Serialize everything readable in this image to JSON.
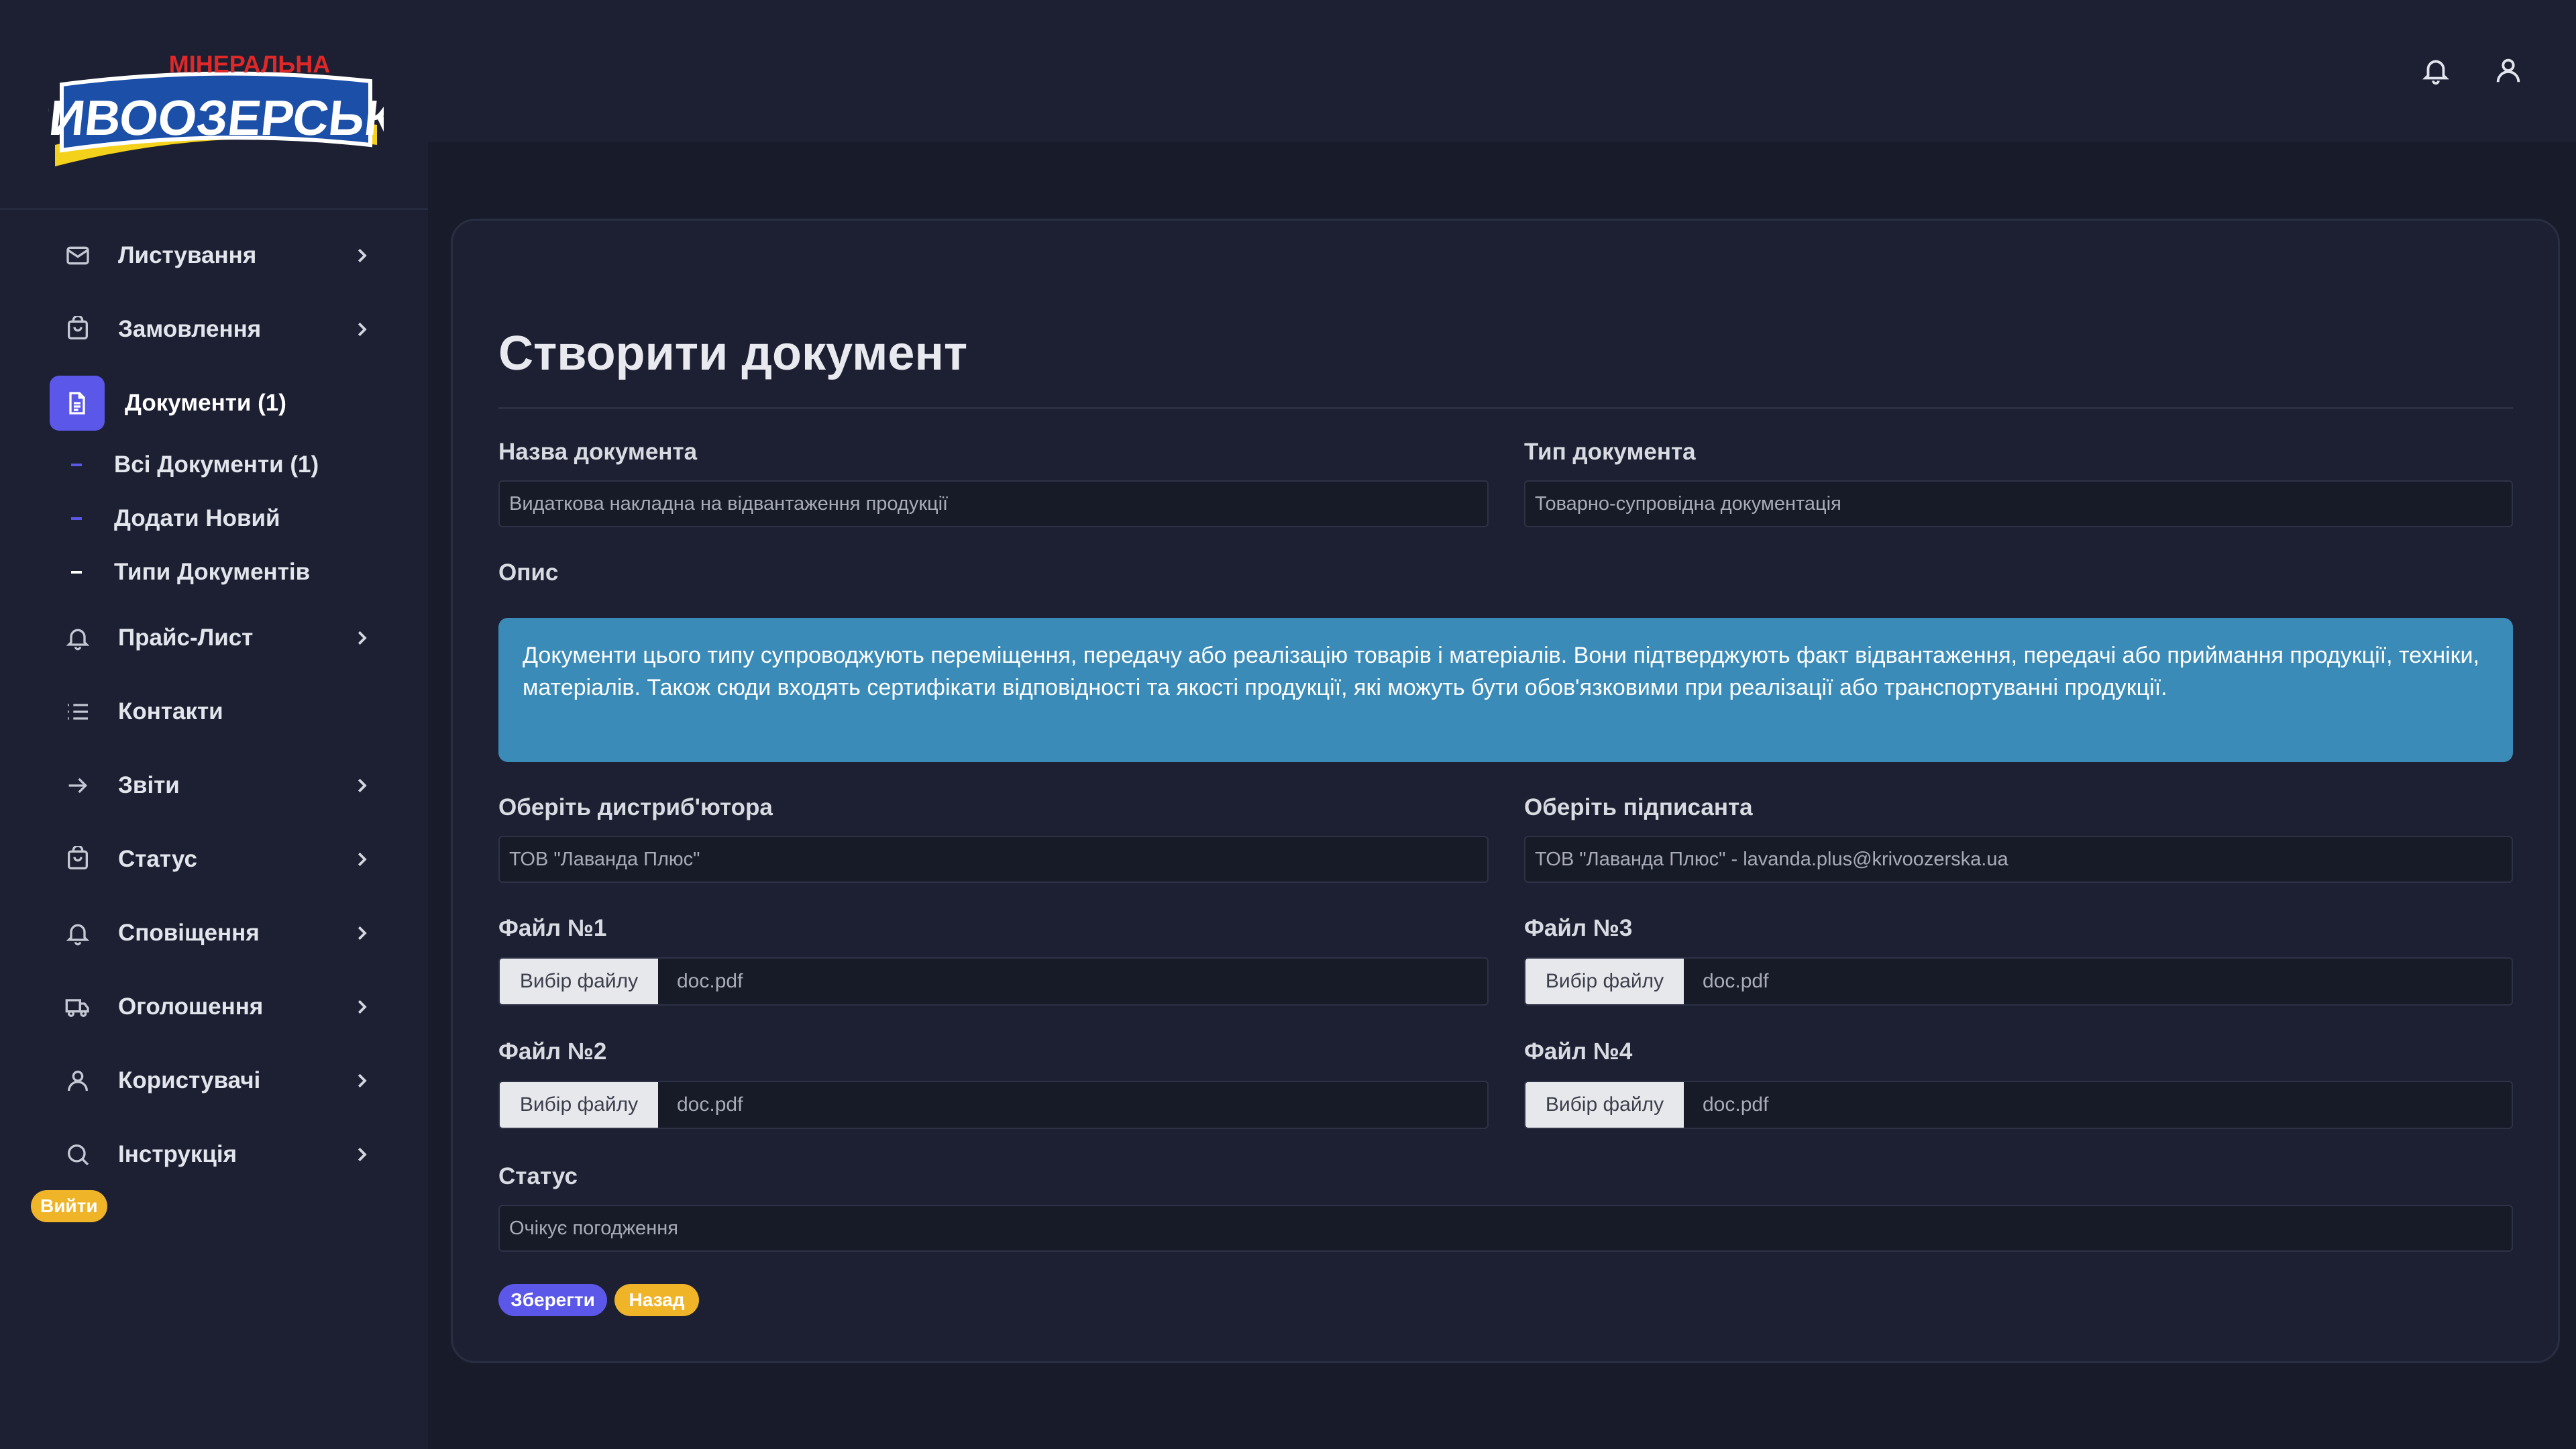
{
  "brand": {
    "logo_top": "МІНЕРАЛЬНА",
    "logo_main": "КРИВООЗЕРСЬКА"
  },
  "sidebar": {
    "items": [
      {
        "label": "Листування",
        "icon": "mail-icon",
        "chevron": true
      },
      {
        "label": "Замовлення",
        "icon": "cart-icon",
        "chevron": true
      },
      {
        "label": "Документи (1)",
        "icon": "document-icon",
        "chevron": false,
        "active": true
      },
      {
        "label": "Прайс-Лист",
        "icon": "bell-icon",
        "chevron": true
      },
      {
        "label": "Контакти",
        "icon": "list-icon",
        "chevron": false
      },
      {
        "label": "Звіти",
        "icon": "arrow-right-icon",
        "chevron": true
      },
      {
        "label": "Статус",
        "icon": "cart-icon",
        "chevron": true
      },
      {
        "label": "Сповіщення",
        "icon": "bell-icon",
        "chevron": true
      },
      {
        "label": "Оголошення",
        "icon": "truck-icon",
        "chevron": true
      },
      {
        "label": "Користувачі",
        "icon": "user-icon",
        "chevron": true
      },
      {
        "label": "Інструкція",
        "icon": "search-icon",
        "chevron": true
      }
    ],
    "sub_items": [
      {
        "label": "Всі Документи (1)"
      },
      {
        "label": "Додати Новий"
      },
      {
        "label": "Типи Документів"
      }
    ],
    "logout_label": "Вийти"
  },
  "header": {
    "icons": [
      "bell-icon",
      "user-icon"
    ]
  },
  "form": {
    "title": "Створити документ",
    "name_label": "Назва документа",
    "name_value": "Видаткова накладна на відвантаження продукції",
    "type_label": "Тип документа",
    "type_value": "Товарно-супровідна документація",
    "desc_label": "Опис",
    "desc_text": "Документи цього типу супроводжують переміщення, передачу або реалізацію товарів і матеріалів. Вони підтверджують факт відвантаження, передачі або приймання продукції, техніки, матеріалів. Також сюди входять сертифікати відповідності та якості продукції, які можуть бути обов'язковими при реалізації або транспортуванні продукції.",
    "distributor_label": "Оберіть дистриб'ютора",
    "distributor_value": "ТОВ \"Лаванда Плюс\"",
    "signer_label": "Оберіть підписанта",
    "signer_value": "ТОВ \"Лаванда Плюс\" - lavanda.plus@krivoozerska.ua",
    "files": [
      {
        "label": "Файл №1",
        "button": "Вибір файлу",
        "filename": "doc.pdf"
      },
      {
        "label": "Файл №2",
        "button": "Вибір файлу",
        "filename": "doc.pdf"
      },
      {
        "label": "Файл №3",
        "button": "Вибір файлу",
        "filename": "doc.pdf"
      },
      {
        "label": "Файл №4",
        "button": "Вибір файлу",
        "filename": "doc.pdf"
      }
    ],
    "status_label": "Статус",
    "status_value": "Очікує погодження",
    "save_label": "Зберегти",
    "back_label": "Назад"
  },
  "colors": {
    "background": "#181b29",
    "panel": "#1d2032",
    "accent": "#5b57e8",
    "warning": "#f0b429",
    "info": "#3b8bb8"
  }
}
